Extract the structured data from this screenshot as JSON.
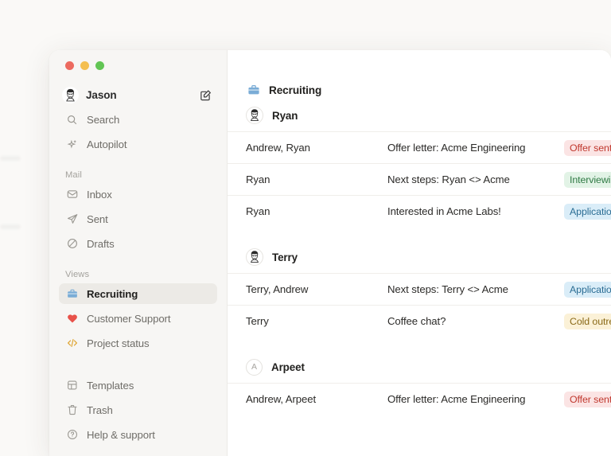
{
  "window": {
    "traffic_lights": [
      {
        "name": "close",
        "color": "#ec6a5f"
      },
      {
        "name": "minimize",
        "color": "#f4bf50"
      },
      {
        "name": "maximize",
        "color": "#62c554"
      }
    ]
  },
  "sidebar": {
    "user": {
      "name": "Jason",
      "compose_tooltip": "Compose"
    },
    "quick_items": [
      {
        "label": "Search",
        "icon": "search-icon"
      },
      {
        "label": "Autopilot",
        "icon": "sparkle-icon"
      }
    ],
    "mail_section": {
      "label": "Mail",
      "items": [
        {
          "label": "Inbox",
          "icon": "inbox-icon"
        },
        {
          "label": "Sent",
          "icon": "send-icon"
        },
        {
          "label": "Drafts",
          "icon": "drafts-icon"
        }
      ]
    },
    "views_section": {
      "label": "Views",
      "items": [
        {
          "label": "Recruiting",
          "icon": "briefcase-icon",
          "color": "#7aacd6",
          "active": true
        },
        {
          "label": "Customer Support",
          "icon": "heart-icon",
          "color": "#e8524a",
          "active": false
        },
        {
          "label": "Project status",
          "icon": "code-icon",
          "color": "#e0a93c",
          "active": false
        }
      ]
    },
    "footer_items": [
      {
        "label": "Templates",
        "icon": "templates-icon"
      },
      {
        "label": "Trash",
        "icon": "trash-icon"
      },
      {
        "label": "Help & support",
        "icon": "help-icon"
      }
    ]
  },
  "main": {
    "view_title": "Recruiting",
    "view_icon": "briefcase-icon",
    "groups": [
      {
        "name": "Ryan",
        "avatar_type": "face",
        "rows": [
          {
            "from": "Andrew, Ryan",
            "subject": "Offer letter: Acme Engineering",
            "badge": "Offer sent",
            "badge_bg": "#fbe4e4",
            "badge_fg": "#c0392f"
          },
          {
            "from": "Ryan",
            "subject": "Next steps: Ryan <> Acme",
            "badge": "Interviewing",
            "badge_bg": "#e2f3e6",
            "badge_fg": "#2f7a44"
          },
          {
            "from": "Ryan",
            "subject": "Interested in Acme Labs!",
            "badge": "Application",
            "badge_bg": "#daedf8",
            "badge_fg": "#2b6d94"
          }
        ]
      },
      {
        "name": "Terry",
        "avatar_type": "face",
        "rows": [
          {
            "from": "Terry, Andrew",
            "subject": "Next steps: Terry <> Acme",
            "badge": "Application",
            "badge_bg": "#daedf8",
            "badge_fg": "#2b6d94"
          },
          {
            "from": "Terry",
            "subject": "Coffee chat?",
            "badge": "Cold outreach",
            "badge_bg": "#fbf1d7",
            "badge_fg": "#8a6a18"
          }
        ]
      },
      {
        "name": "Arpeet",
        "avatar_type": "initial",
        "avatar_initial": "A",
        "rows": [
          {
            "from": "Andrew, Arpeet",
            "subject": "Offer letter: Acme Engineering",
            "badge": "Offer sent",
            "badge_bg": "#fbe4e4",
            "badge_fg": "#c0392f"
          }
        ]
      }
    ]
  }
}
